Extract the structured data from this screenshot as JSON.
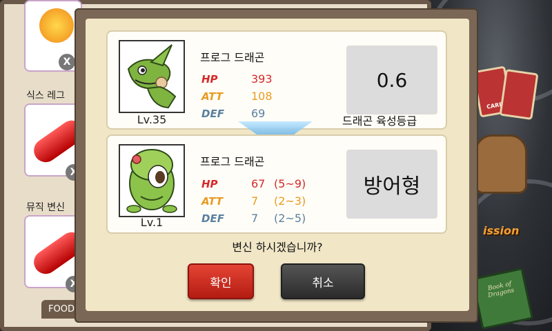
{
  "shop": {
    "items": [
      {
        "title": "",
        "badge": "X"
      },
      {
        "title": "식스 레그",
        "badge": "X"
      },
      {
        "title": "뮤직 변신",
        "badge": "X"
      }
    ],
    "tab_label": "FOOD"
  },
  "side_menu": {
    "card_label": "CARD",
    "mission_label": "ission",
    "book_title": "Book of Dragons"
  },
  "dialog": {
    "current": {
      "name": "프로그 드래곤",
      "level": "Lv.35",
      "stats": [
        {
          "label": "HP",
          "value": "393",
          "color": "#d42a2a"
        },
        {
          "label": "ATT",
          "value": "108",
          "color": "#e89b22"
        },
        {
          "label": "DEF",
          "value": "69",
          "color": "#5a7fa0"
        }
      ],
      "grade_value": "0.6",
      "grade_label": "드래곤 육성등급"
    },
    "next": {
      "name": "프로그 드래곤",
      "level": "Lv.1",
      "stats": [
        {
          "label": "HP",
          "value": "67",
          "range": "(5~9)",
          "color": "#d42a2a"
        },
        {
          "label": "ATT",
          "value": "7",
          "range": "(2~3)",
          "color": "#e89b22"
        },
        {
          "label": "DEF",
          "value": "7",
          "range": "(2~5)",
          "color": "#5a7fa0"
        }
      ],
      "type_label": "방어형"
    },
    "question": "변신 하시겠습니까?",
    "confirm_label": "확인",
    "cancel_label": "취소"
  }
}
